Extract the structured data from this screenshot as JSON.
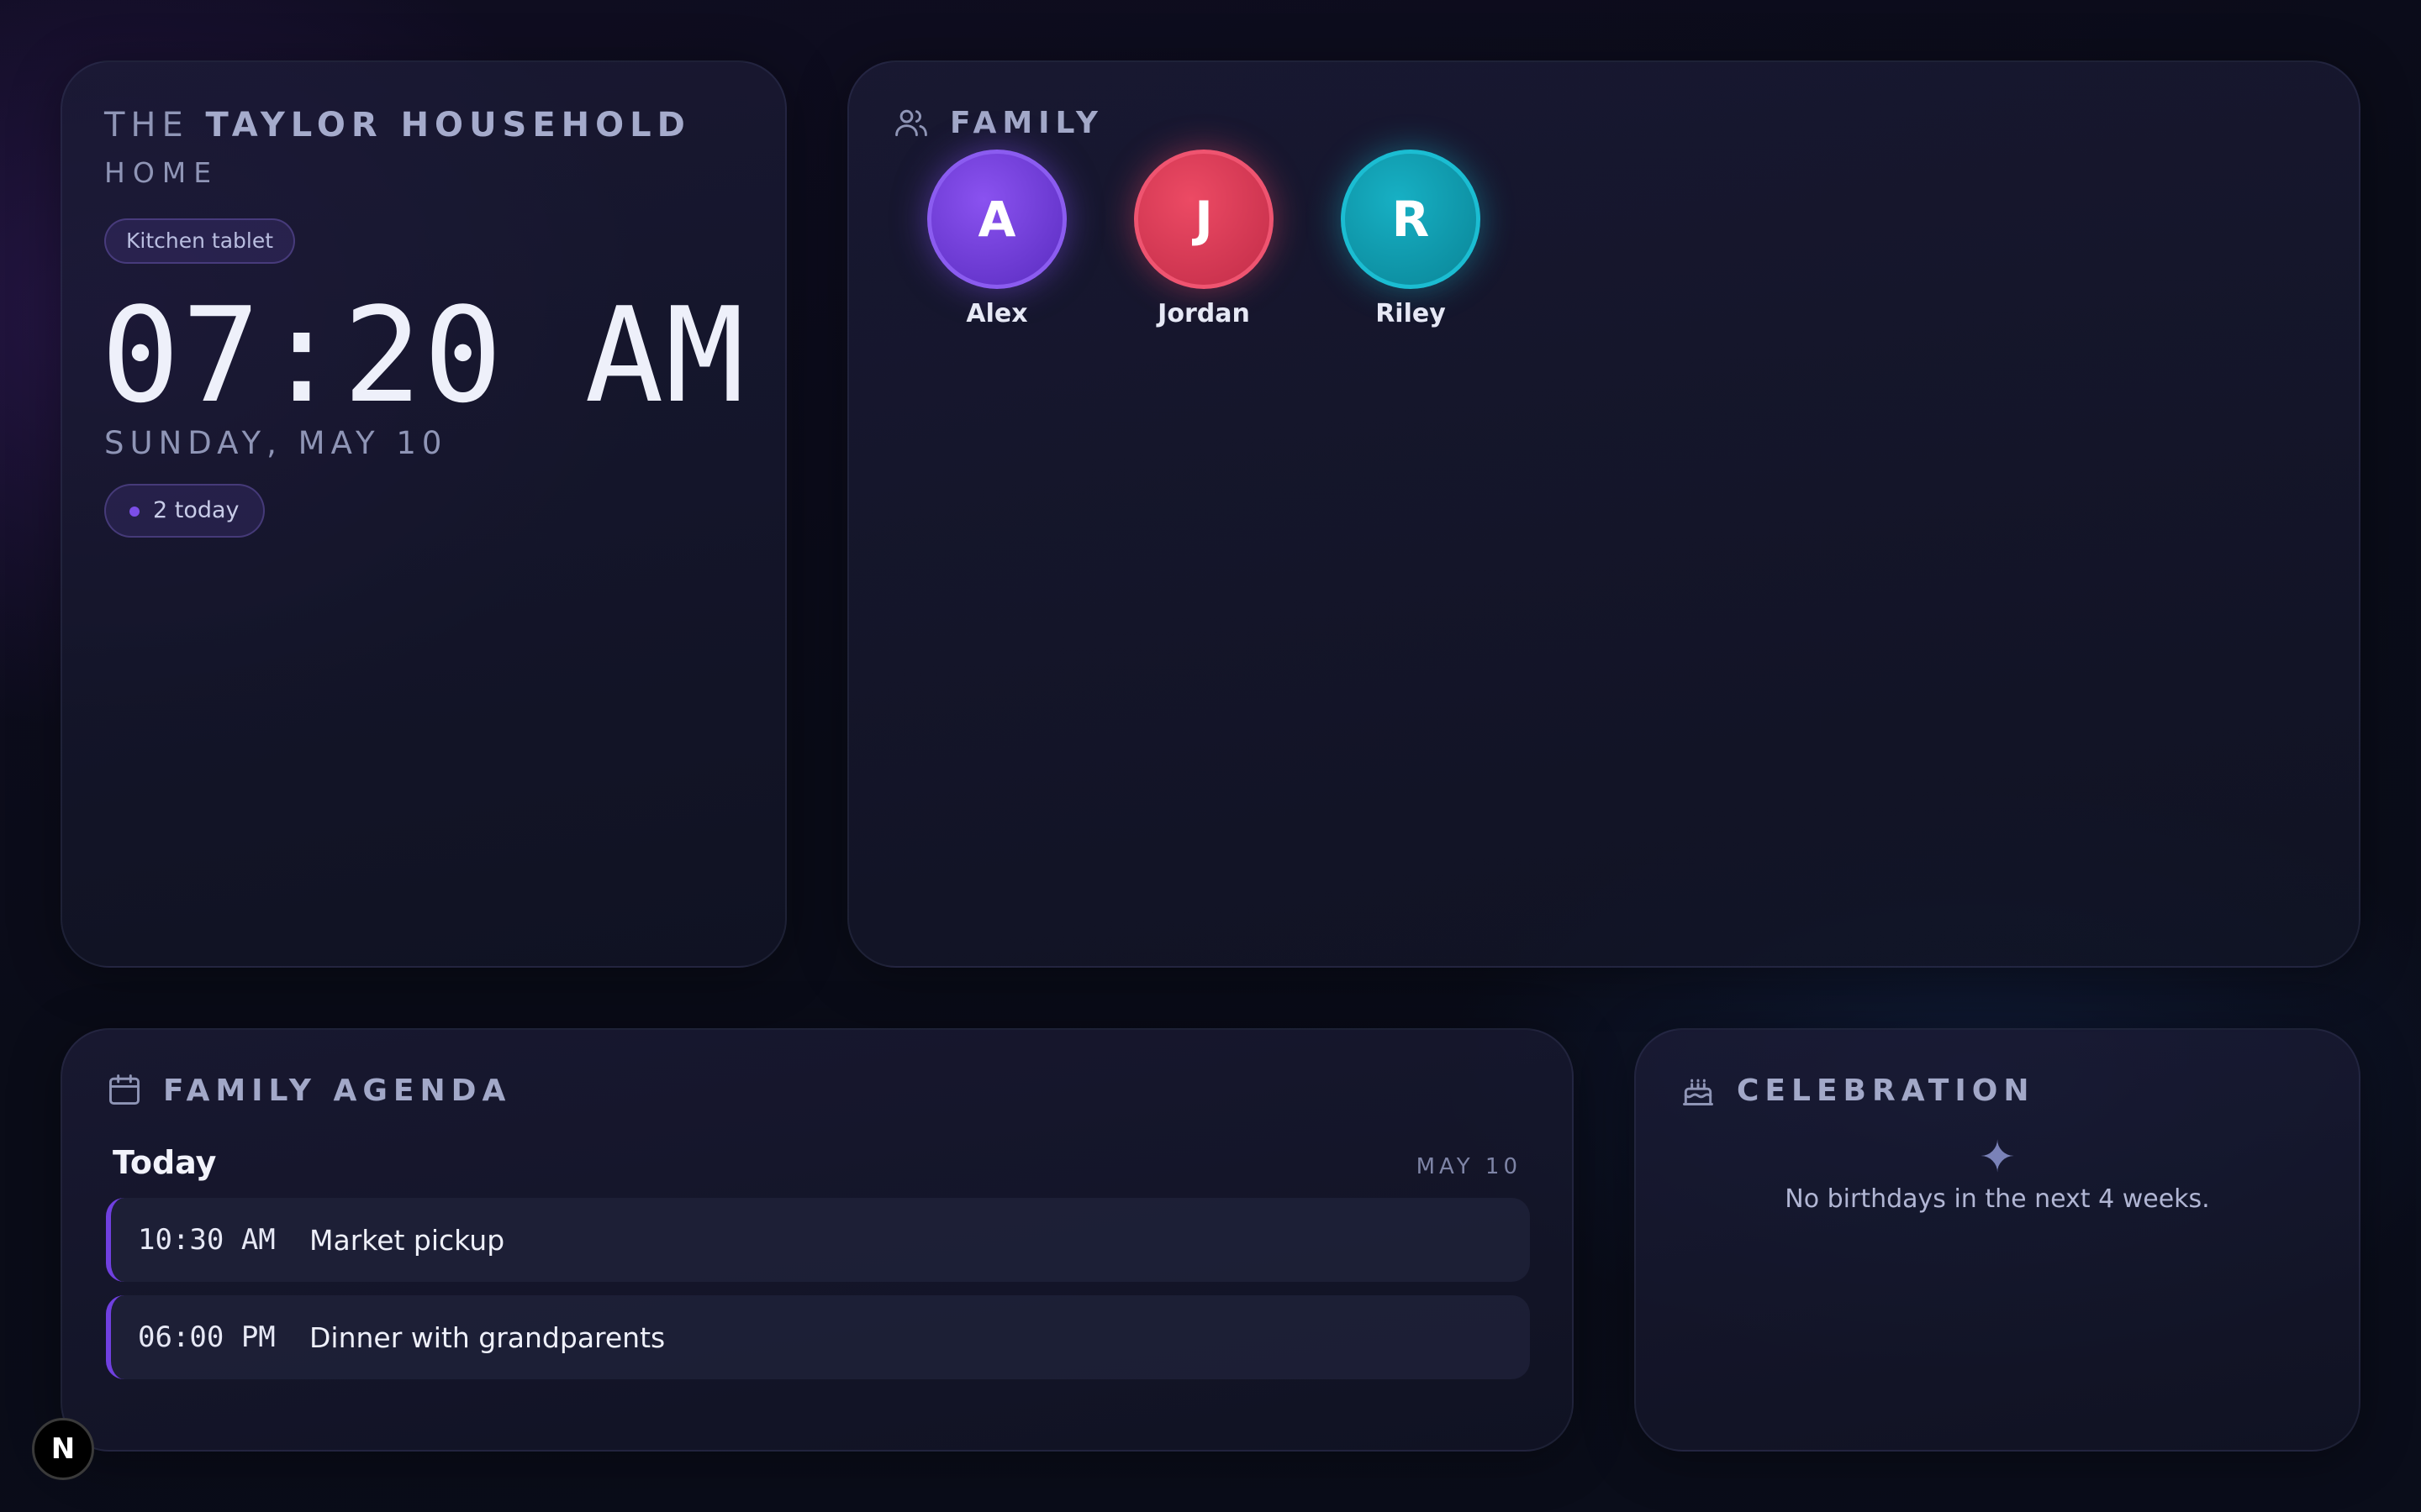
{
  "home": {
    "title_prefix": "THE",
    "title_name": "TAYLOR HOUSEHOLD",
    "subtitle": "HOME",
    "device_label": "Kitchen tablet",
    "time": "07:20 AM",
    "date": "SUNDAY, MAY 10",
    "events_today": "2 today"
  },
  "family": {
    "heading": "FAMILY",
    "members": [
      {
        "initial": "A",
        "name": "Alex",
        "color": "#7c4ee8"
      },
      {
        "initial": "J",
        "name": "Jordan",
        "color": "#e04660"
      },
      {
        "initial": "R",
        "name": "Riley",
        "color": "#13a6b9"
      }
    ]
  },
  "agenda": {
    "heading": "FAMILY AGENDA",
    "day_label": "Today",
    "date": "MAY 10",
    "events": [
      {
        "time": "10:30 AM",
        "title": "Market pickup"
      },
      {
        "time": "06:00 PM",
        "title": "Dinner with grandparents"
      }
    ]
  },
  "celebration": {
    "heading": "CELEBRATION",
    "empty_message": "No birthdays in the next 4 weeks."
  },
  "corner_badge": "N",
  "colors": {
    "accent": "#7c4ee8",
    "background": "#0b0d1a"
  }
}
